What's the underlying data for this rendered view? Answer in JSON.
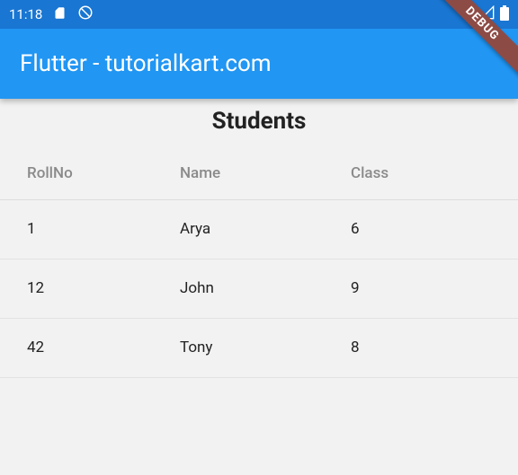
{
  "status": {
    "time": "11:18",
    "icons_left": [
      "sd-card-icon",
      "dnd-icon"
    ],
    "icons_right": [
      "wifi-icon",
      "signal-icon",
      "battery-icon"
    ]
  },
  "appbar": {
    "title": "Flutter - tutorialkart.com"
  },
  "debug_banner": "DEBUG",
  "page": {
    "heading": "Students",
    "columns": {
      "rollno": "RollNo",
      "name": "Name",
      "class": "Class"
    },
    "rows": [
      {
        "rollno": "1",
        "name": "Arya",
        "class": "6"
      },
      {
        "rollno": "12",
        "name": "John",
        "class": "9"
      },
      {
        "rollno": "42",
        "name": "Tony",
        "class": "8"
      }
    ]
  }
}
